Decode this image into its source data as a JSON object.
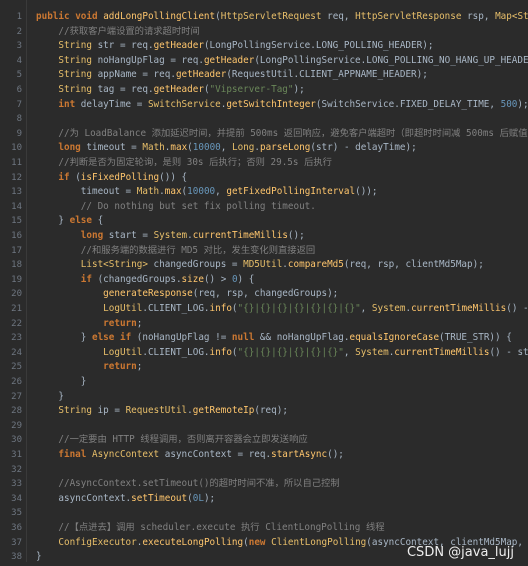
{
  "editor": {
    "lines": [
      {
        "n": "1",
        "t": [
          [
            "kw",
            "public "
          ],
          [
            "kw",
            "void "
          ],
          [
            "fn",
            "addLongPollingClient"
          ],
          [
            "plain",
            "("
          ],
          [
            "ty",
            "HttpServletRequest "
          ],
          [
            "plain",
            "req, "
          ],
          [
            "ty",
            "HttpServletResponse "
          ],
          [
            "plain",
            "rsp, "
          ],
          [
            "ty",
            "Map<String, "
          ]
        ]
      },
      {
        "n": "2",
        "t": [
          [
            "cm",
            "    //获取客户端设置的请求超时时间"
          ]
        ]
      },
      {
        "n": "3",
        "t": [
          [
            "plain",
            "    "
          ],
          [
            "ty",
            "String "
          ],
          [
            "plain",
            "str = req."
          ],
          [
            "fn",
            "getHeader"
          ],
          [
            "plain",
            "(LongPollingService.LONG_POLLING_HEADER);"
          ]
        ]
      },
      {
        "n": "4",
        "t": [
          [
            "plain",
            "    "
          ],
          [
            "ty",
            "String "
          ],
          [
            "plain",
            "noHangUpFlag = req."
          ],
          [
            "fn",
            "getHeader"
          ],
          [
            "plain",
            "(LongPollingService.LONG_POLLING_NO_HANG_UP_HEADER);"
          ]
        ]
      },
      {
        "n": "5",
        "t": [
          [
            "plain",
            "    "
          ],
          [
            "ty",
            "String "
          ],
          [
            "plain",
            "appName = req."
          ],
          [
            "fn",
            "getHeader"
          ],
          [
            "plain",
            "(RequestUtil.CLIENT_APPNAME_HEADER);"
          ]
        ]
      },
      {
        "n": "6",
        "t": [
          [
            "plain",
            "    "
          ],
          [
            "ty",
            "String "
          ],
          [
            "plain",
            "tag = req."
          ],
          [
            "fn",
            "getHeader"
          ],
          [
            "plain",
            "("
          ],
          [
            "st",
            "\"Vipserver-Tag\""
          ],
          [
            "plain",
            ");"
          ]
        ]
      },
      {
        "n": "7",
        "t": [
          [
            "plain",
            "    "
          ],
          [
            "kw",
            "int "
          ],
          [
            "plain",
            "delayTime = "
          ],
          [
            "ty",
            "SwitchService"
          ],
          [
            "plain",
            "."
          ],
          [
            "fn",
            "getSwitchInteger"
          ],
          [
            "plain",
            "(SwitchService.FIXED_DELAY_TIME, "
          ],
          [
            "num",
            "500"
          ],
          [
            "plain",
            ");"
          ]
        ]
      },
      {
        "n": "8",
        "t": [
          [
            "plain",
            ""
          ]
        ]
      },
      {
        "n": "9",
        "t": [
          [
            "cm",
            "    //为 LoadBalance 添加延迟时间，并提前 500ms 返回响应，避免客户端超时（即超时时间减 500ms 后赋值"
          ]
        ]
      },
      {
        "n": "10",
        "t": [
          [
            "plain",
            "    "
          ],
          [
            "kw",
            "long "
          ],
          [
            "plain",
            "timeout = "
          ],
          [
            "ty",
            "Math"
          ],
          [
            "plain",
            "."
          ],
          [
            "fn",
            "max"
          ],
          [
            "plain",
            "("
          ],
          [
            "num",
            "10000"
          ],
          [
            "plain",
            ", "
          ],
          [
            "ty",
            "Long"
          ],
          [
            "plain",
            "."
          ],
          [
            "fn",
            "parseLong"
          ],
          [
            "plain",
            "(str) - delayTime);"
          ]
        ]
      },
      {
        "n": "11",
        "t": [
          [
            "cm",
            "    //判断是否为固定轮询，是则 30s 后执行；否则 29.5s 后执行"
          ]
        ]
      },
      {
        "n": "12",
        "t": [
          [
            "plain",
            "    "
          ],
          [
            "kw",
            "if "
          ],
          [
            "plain",
            "("
          ],
          [
            "fn",
            "isFixedPolling"
          ],
          [
            "plain",
            "()) {"
          ]
        ]
      },
      {
        "n": "13",
        "t": [
          [
            "plain",
            "        timeout = "
          ],
          [
            "ty",
            "Math"
          ],
          [
            "plain",
            "."
          ],
          [
            "fn",
            "max"
          ],
          [
            "plain",
            "("
          ],
          [
            "num",
            "10000"
          ],
          [
            "plain",
            ", "
          ],
          [
            "fn",
            "getFixedPollingInterval"
          ],
          [
            "plain",
            "());"
          ]
        ]
      },
      {
        "n": "14",
        "t": [
          [
            "cm",
            "        // Do nothing but set fix polling timeout."
          ]
        ]
      },
      {
        "n": "15",
        "t": [
          [
            "plain",
            "    } "
          ],
          [
            "kw",
            "else "
          ],
          [
            "plain",
            "{"
          ]
        ]
      },
      {
        "n": "16",
        "t": [
          [
            "plain",
            "        "
          ],
          [
            "kw",
            "long "
          ],
          [
            "plain",
            "start = "
          ],
          [
            "ty",
            "System"
          ],
          [
            "plain",
            "."
          ],
          [
            "fn",
            "currentTimeMillis"
          ],
          [
            "plain",
            "();"
          ]
        ]
      },
      {
        "n": "17",
        "t": [
          [
            "cm",
            "        //和服务端的数据进行 MD5 对比，发生变化则直接返回"
          ]
        ]
      },
      {
        "n": "18",
        "t": [
          [
            "plain",
            "        "
          ],
          [
            "ty",
            "List<String> "
          ],
          [
            "plain",
            "changedGroups = "
          ],
          [
            "ty",
            "MD5Util"
          ],
          [
            "plain",
            "."
          ],
          [
            "fn",
            "compareMd5"
          ],
          [
            "plain",
            "(req, rsp, clientMd5Map);"
          ]
        ]
      },
      {
        "n": "19",
        "t": [
          [
            "plain",
            "        "
          ],
          [
            "kw",
            "if "
          ],
          [
            "plain",
            "(changedGroups."
          ],
          [
            "fn",
            "size"
          ],
          [
            "plain",
            "() > "
          ],
          [
            "num",
            "0"
          ],
          [
            "plain",
            ") {"
          ]
        ]
      },
      {
        "n": "20",
        "t": [
          [
            "plain",
            "            "
          ],
          [
            "fn",
            "generateResponse"
          ],
          [
            "plain",
            "(req, rsp, changedGroups);"
          ]
        ]
      },
      {
        "n": "21",
        "t": [
          [
            "plain",
            "            "
          ],
          [
            "ty",
            "LogUtil"
          ],
          [
            "plain",
            ".CLIENT_LOG."
          ],
          [
            "fn",
            "info"
          ],
          [
            "plain",
            "("
          ],
          [
            "st",
            "\"{}|{}|{}|{}|{}|{}|{}\""
          ],
          [
            "plain",
            ", "
          ],
          [
            "ty",
            "System"
          ],
          [
            "plain",
            "."
          ],
          [
            "fn",
            "currentTimeMillis"
          ],
          [
            "plain",
            "() - start"
          ]
        ]
      },
      {
        "n": "22",
        "t": [
          [
            "plain",
            "            "
          ],
          [
            "kw",
            "return"
          ],
          [
            "plain",
            ";"
          ]
        ]
      },
      {
        "n": "23",
        "t": [
          [
            "plain",
            "        } "
          ],
          [
            "kw",
            "else if "
          ],
          [
            "plain",
            "(noHangUpFlag != "
          ],
          [
            "kw",
            "null "
          ],
          [
            "plain",
            "&& noHangUpFlag."
          ],
          [
            "fn",
            "equalsIgnoreCase"
          ],
          [
            "plain",
            "(TRUE_STR)) {"
          ]
        ]
      },
      {
        "n": "24",
        "t": [
          [
            "plain",
            "            "
          ],
          [
            "ty",
            "LogUtil"
          ],
          [
            "plain",
            ".CLIENT_LOG."
          ],
          [
            "fn",
            "info"
          ],
          [
            "plain",
            "("
          ],
          [
            "st",
            "\"{}|{}|{}|{}|{}|{}\""
          ],
          [
            "plain",
            ", "
          ],
          [
            "ty",
            "System"
          ],
          [
            "plain",
            "."
          ],
          [
            "fn",
            "currentTimeMillis"
          ],
          [
            "plain",
            "() - start"
          ]
        ]
      },
      {
        "n": "25",
        "t": [
          [
            "plain",
            "            "
          ],
          [
            "kw",
            "return"
          ],
          [
            "plain",
            ";"
          ]
        ]
      },
      {
        "n": "26",
        "t": [
          [
            "plain",
            "        }"
          ]
        ]
      },
      {
        "n": "27",
        "t": [
          [
            "plain",
            "    }"
          ]
        ]
      },
      {
        "n": "28",
        "t": [
          [
            "plain",
            "    "
          ],
          [
            "ty",
            "String "
          ],
          [
            "plain",
            "ip = "
          ],
          [
            "ty",
            "RequestUtil"
          ],
          [
            "plain",
            "."
          ],
          [
            "fn",
            "getRemoteIp"
          ],
          [
            "plain",
            "(req);"
          ]
        ]
      },
      {
        "n": "29",
        "t": [
          [
            "plain",
            ""
          ]
        ]
      },
      {
        "n": "30",
        "t": [
          [
            "cm",
            "    //一定要由 HTTP 线程调用，否则离开容器会立即发送响应"
          ]
        ]
      },
      {
        "n": "31",
        "t": [
          [
            "plain",
            "    "
          ],
          [
            "kw",
            "final "
          ],
          [
            "ty",
            "AsyncContext "
          ],
          [
            "plain",
            "asyncContext = req."
          ],
          [
            "fn",
            "startAsync"
          ],
          [
            "plain",
            "();"
          ]
        ]
      },
      {
        "n": "32",
        "t": [
          [
            "plain",
            ""
          ]
        ]
      },
      {
        "n": "33",
        "t": [
          [
            "cm",
            "    //AsyncContext.setTimeout()的超时时间不准，所以自己控制"
          ]
        ]
      },
      {
        "n": "34",
        "t": [
          [
            "plain",
            "    asyncContext."
          ],
          [
            "fn",
            "setTimeout"
          ],
          [
            "plain",
            "("
          ],
          [
            "num",
            "0L"
          ],
          [
            "plain",
            ");"
          ]
        ]
      },
      {
        "n": "35",
        "t": [
          [
            "plain",
            ""
          ]
        ]
      },
      {
        "n": "36",
        "t": [
          [
            "cm",
            "    //【点进去】调用 scheduler.execute 执行 ClientLongPolling 线程"
          ]
        ]
      },
      {
        "n": "37",
        "t": [
          [
            "plain",
            "    "
          ],
          [
            "ty",
            "ConfigExecutor"
          ],
          [
            "plain",
            "."
          ],
          [
            "fn",
            "executeLongPolling"
          ],
          [
            "plain",
            "("
          ],
          [
            "kw",
            "new "
          ],
          [
            "ty",
            "ClientLongPolling"
          ],
          [
            "plain",
            "(asyncContext, clientMd5Map, ip, pr"
          ]
        ]
      },
      {
        "n": "38",
        "t": [
          [
            "plain",
            "}"
          ]
        ]
      }
    ]
  },
  "watermark": {
    "text": "CSDN @java_lujj"
  }
}
